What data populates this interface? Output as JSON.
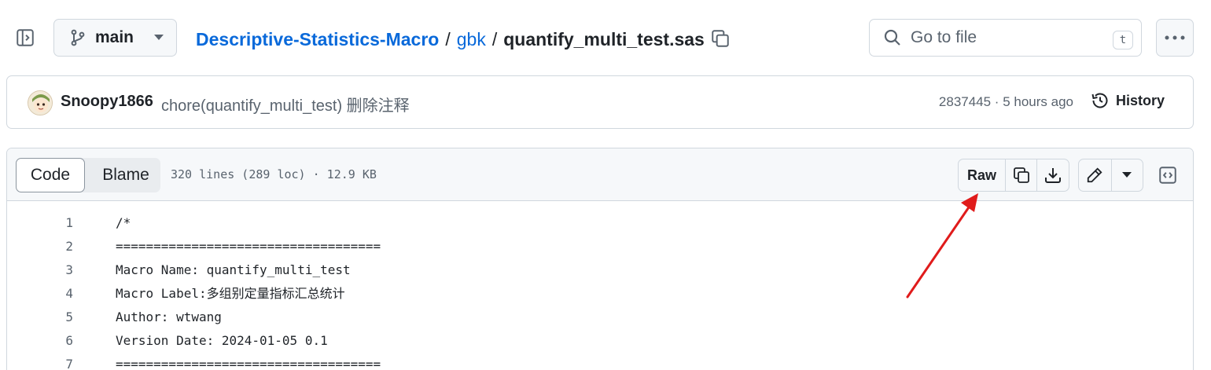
{
  "repo_nav": {
    "branch": "main",
    "breadcrumb": {
      "repo": "Descriptive-Statistics-Macro",
      "folder": "gbk",
      "separator": "/",
      "file": "quantify_multi_test.sas"
    },
    "search": {
      "placeholder": "Go to file",
      "shortcut": "t"
    }
  },
  "commit": {
    "author": "Snoopy1866",
    "message": "chore(quantify_multi_test) 删除注释",
    "meta": "2837445 · 5 hours ago",
    "history_label": "History"
  },
  "file_view": {
    "tabs": [
      "Code",
      "Blame"
    ],
    "active_tab": "Code",
    "info": "320 lines (289 loc) · 12.9 KB",
    "raw_label": "Raw",
    "lines": [
      {
        "n": "1",
        "text": "/*"
      },
      {
        "n": "2",
        "text": "==================================="
      },
      {
        "n": "3",
        "text": "Macro Name: quantify_multi_test"
      },
      {
        "n": "4",
        "text": "Macro Label:多组别定量指标汇总统计"
      },
      {
        "n": "5",
        "text": "Author: wtwang"
      },
      {
        "n": "6",
        "text": "Version Date: 2024-01-05 0.1"
      },
      {
        "n": "7",
        "text": "==================================="
      }
    ]
  },
  "colors": {
    "link": "#0969da",
    "border": "#d0d7de",
    "muted": "#59636e",
    "annotation_arrow": "#e01b1b"
  }
}
